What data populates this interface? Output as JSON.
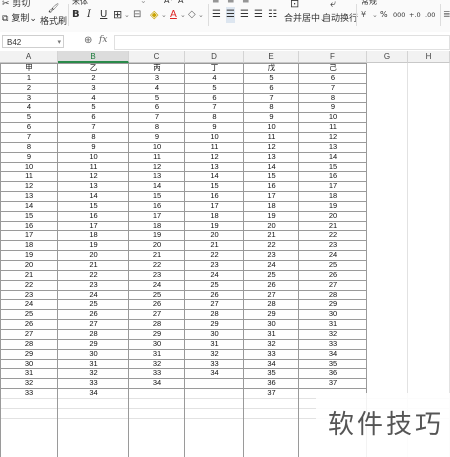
{
  "toolbar": {
    "cut_label": "剪切",
    "copy_label": "复制",
    "format_painter_label": "格式刷",
    "font_name": "宋体",
    "merge_label": "合并居中",
    "wrap_label": "自动换行",
    "number_format": "常规",
    "bold": "B",
    "italic": "I",
    "underline": "U",
    "percent": "%",
    "comma": "000",
    "dec_inc": "+.0",
    "dec_dec": ".00",
    "fx_label": "fx"
  },
  "namebox": {
    "value": "B42"
  },
  "columns": [
    "A",
    "B",
    "C",
    "D",
    "E",
    "F",
    "G",
    "H"
  ],
  "selected_column": "B",
  "sheet": {
    "headers": [
      "甲",
      "乙",
      "丙",
      "丁",
      "戊",
      "己"
    ],
    "rows": [
      [
        "1",
        "2",
        "3",
        "4",
        "5",
        "6"
      ],
      [
        "2",
        "3",
        "4",
        "5",
        "6",
        "7"
      ],
      [
        "3",
        "4",
        "5",
        "6",
        "7",
        "8"
      ],
      [
        "4",
        "5",
        "6",
        "7",
        "8",
        "9"
      ],
      [
        "5",
        "6",
        "7",
        "8",
        "9",
        "10"
      ],
      [
        "6",
        "7",
        "8",
        "9",
        "10",
        "11"
      ],
      [
        "7",
        "8",
        "9",
        "10",
        "11",
        "12"
      ],
      [
        "8",
        "9",
        "10",
        "11",
        "12",
        "13"
      ],
      [
        "9",
        "10",
        "11",
        "12",
        "13",
        "14"
      ],
      [
        "10",
        "11",
        "12",
        "13",
        "14",
        "15"
      ],
      [
        "11",
        "12",
        "13",
        "14",
        "15",
        "16"
      ],
      [
        "12",
        "13",
        "14",
        "15",
        "16",
        "17"
      ],
      [
        "13",
        "14",
        "15",
        "16",
        "17",
        "18"
      ],
      [
        "14",
        "15",
        "16",
        "17",
        "18",
        "19"
      ],
      [
        "15",
        "16",
        "17",
        "18",
        "19",
        "20"
      ],
      [
        "16",
        "17",
        "18",
        "19",
        "20",
        "21"
      ],
      [
        "17",
        "18",
        "19",
        "20",
        "21",
        "22"
      ],
      [
        "18",
        "19",
        "20",
        "21",
        "22",
        "23"
      ],
      [
        "19",
        "20",
        "21",
        "22",
        "23",
        "24"
      ],
      [
        "20",
        "21",
        "22",
        "23",
        "24",
        "25"
      ],
      [
        "21",
        "22",
        "23",
        "24",
        "25",
        "26"
      ],
      [
        "22",
        "23",
        "24",
        "25",
        "26",
        "27"
      ],
      [
        "23",
        "24",
        "25",
        "26",
        "27",
        "28"
      ],
      [
        "24",
        "25",
        "26",
        "27",
        "28",
        "29"
      ],
      [
        "25",
        "26",
        "27",
        "28",
        "29",
        "30"
      ],
      [
        "26",
        "27",
        "28",
        "29",
        "30",
        "31"
      ],
      [
        "27",
        "28",
        "29",
        "30",
        "31",
        "32"
      ],
      [
        "28",
        "29",
        "30",
        "31",
        "32",
        "33"
      ],
      [
        "29",
        "30",
        "31",
        "32",
        "33",
        "34"
      ],
      [
        "30",
        "31",
        "32",
        "33",
        "34",
        "35"
      ],
      [
        "31",
        "32",
        "33",
        "34",
        "35",
        "36"
      ],
      [
        "32",
        "33",
        "34",
        "",
        "36",
        "37"
      ],
      [
        "33",
        "34",
        "",
        "",
        "37",
        ""
      ]
    ]
  },
  "watermark": "软件技巧"
}
